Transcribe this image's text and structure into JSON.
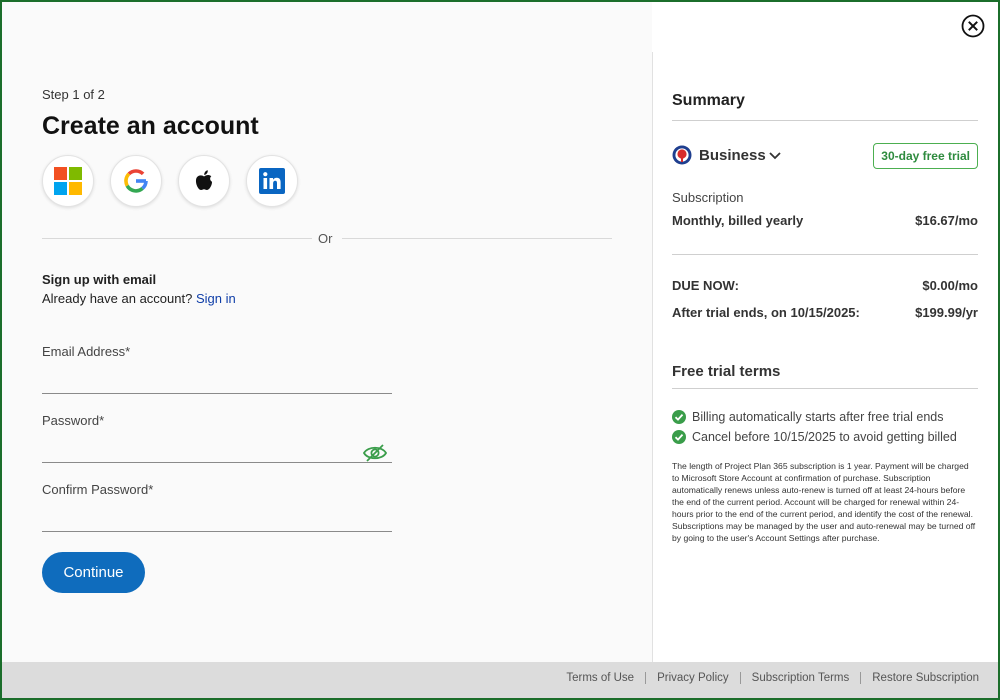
{
  "signup": {
    "step": "Step 1 of 2",
    "title": "Create an account",
    "social": [
      "microsoft-icon",
      "google-icon",
      "apple-icon",
      "linkedin-icon"
    ],
    "or": "Or",
    "email_heading": "Sign up with email",
    "have_account": "Already have an account?",
    "sign_in": "Sign in",
    "email_label": "Email Address*",
    "email_value": "",
    "password_label": "Password*",
    "password_value": "",
    "confirm_label": "Confirm Password*",
    "confirm_value": "",
    "continue": "Continue"
  },
  "summary": {
    "heading": "Summary",
    "plan": "Business",
    "trial_badge": "30-day free trial",
    "subscription_label": "Subscription",
    "billing": "Monthly, billed yearly",
    "price": "$16.67/mo",
    "due_now_label": "DUE NOW:",
    "due_now_value": "$0.00/mo",
    "after_trial_label": "After trial ends, on 10/15/2025:",
    "after_trial_value": "$199.99/yr"
  },
  "terms": {
    "heading": "Free trial terms",
    "items": [
      "Billing automatically starts after free trial ends",
      "Cancel before 10/15/2025 to avoid getting billed"
    ],
    "fine_print": "The length of Project Plan 365 subscription is 1 year. Payment will be charged to Microsoft Store Account at confirmation of purchase. Subscription automatically renews unless auto-renew is turned off at least 24-hours before the end of the current period. Account will be charged for renewal within 24-hours prior to the end of the current period, and identify the cost of the renewal. Subscriptions may be managed by the user and auto-renewal may be turned off by going to the user's Account Settings after purchase."
  },
  "footer": {
    "links": [
      "Terms of Use",
      "Privacy Policy",
      "Subscription Terms",
      "Restore Subscription"
    ]
  },
  "colors": {
    "frame_border": "#1b6e2b",
    "primary": "#0f6cbd",
    "link": "#0f3ea8",
    "trial_green": "#4caf50",
    "check_green": "#3a9d4a"
  }
}
